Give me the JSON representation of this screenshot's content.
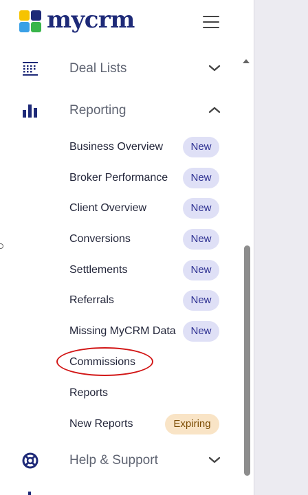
{
  "brand": {
    "logo_text": "mycrm"
  },
  "nav": {
    "deal_lists": {
      "label": "Deal Lists",
      "icon": "list-grid-icon",
      "expanded": false
    },
    "reporting": {
      "label": "Reporting",
      "icon": "bar-chart-icon",
      "expanded": true,
      "items": [
        {
          "label": "Business Overview",
          "badge": "New"
        },
        {
          "label": "Broker Performance",
          "badge": "New"
        },
        {
          "label": "Client Overview",
          "badge": "New"
        },
        {
          "label": "Conversions",
          "badge": "New"
        },
        {
          "label": "Settlements",
          "badge": "New"
        },
        {
          "label": "Referrals",
          "badge": "New"
        },
        {
          "label": "Missing MyCRM Data",
          "badge": "New"
        },
        {
          "label": "Commissions",
          "badge": "",
          "highlighted": true
        },
        {
          "label": "Reports",
          "badge": ""
        },
        {
          "label": "New Reports",
          "badge": "Expiring"
        }
      ]
    },
    "help_support": {
      "label": "Help & Support",
      "icon": "lifebuoy-icon",
      "expanded": false
    }
  },
  "colors": {
    "brand_navy": "#1e2a78",
    "badge_new_bg": "#dfe0f6",
    "badge_expiring_bg": "#f9e4c6",
    "highlight_red": "#d21717"
  }
}
